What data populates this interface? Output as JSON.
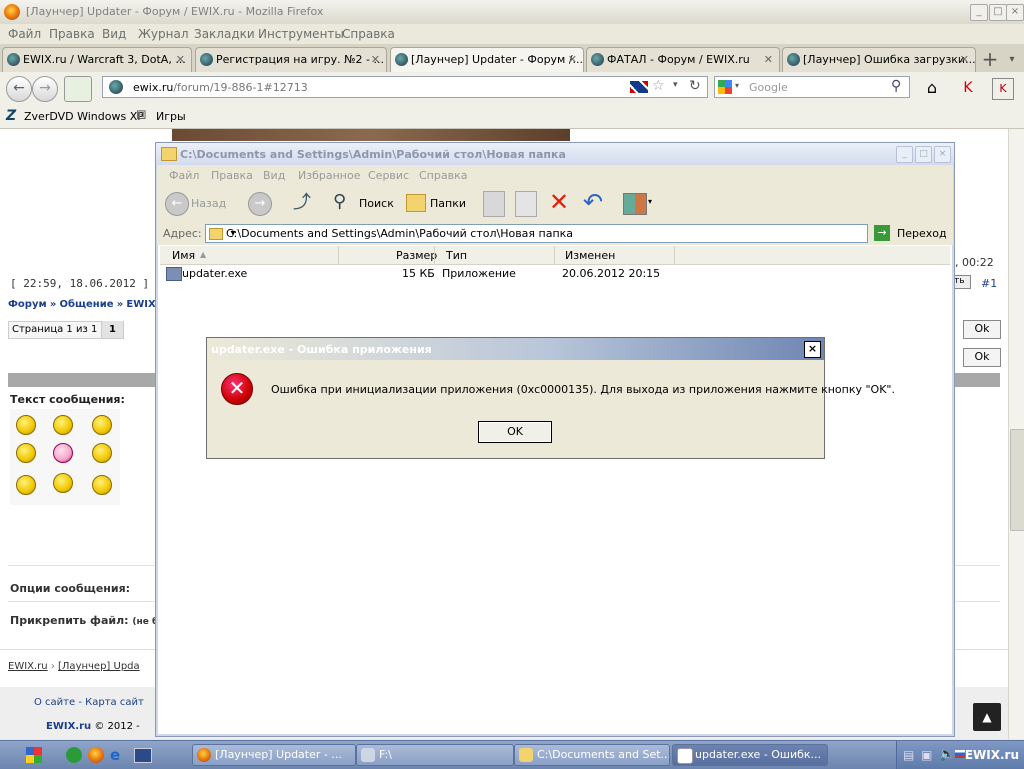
{
  "firefox": {
    "title": "[Лаунчер] Updater - Форум / EWIX.ru - Mozilla Firefox",
    "menu": [
      "Файл",
      "Правка",
      "Вид",
      "Журнал",
      "Закладки",
      "Инструменты",
      "Справка"
    ],
    "tabs": [
      {
        "label": "EWIX.ru / Warcraft 3, DotA, ..."
      },
      {
        "label": "Регистрация на игру. №2 - ..."
      },
      {
        "label": "[Лаунчер] Updater - Форум /..."
      },
      {
        "label": "ФАТАЛ - Форум / EWIX.ru"
      },
      {
        "label": "[Лаунчер] Ошибка загрузки..."
      }
    ],
    "url_host": "ewix.ru",
    "url_path": "/forum/19-886-1#12713",
    "search_placeholder": "Google",
    "bookmarks": [
      "ZverDVD Windows XP",
      "Игры"
    ]
  },
  "page": {
    "timestamp": "[ 22:59, 18.06.2012 ]",
    "timestamp_right": ", 00:22",
    "post_number": "#1",
    "breadcrumb_forum": "Форум",
    "breadcrumb_general": "Общение",
    "breadcrumb_ewix": "EWIX.",
    "pager_text": "Страница 1 из 1",
    "pager_current": "1",
    "ok_label": "Ok",
    "message_label": "Текст сообщения:",
    "options_label": "Опции сообщения:",
    "attach_label": "Прикрепить файл:",
    "attach_note": "(не б",
    "footer_crumb_site": "EWIX.ru",
    "footer_crumb_topic": "[Лаунчер] Upda",
    "footer_links": "О сайте - Карта сайт",
    "footer_copy_brand": "EWIX.ru",
    "footer_copy": " © 2012 -",
    "page_button_ok_partial": "ть"
  },
  "explorer": {
    "title": "C:\\Documents and Settings\\Admin\\Рабочий стол\\Новая папка",
    "menu": [
      "Файл",
      "Правка",
      "Вид",
      "Избранное",
      "Сервис",
      "Справка"
    ],
    "back_label": "Назад",
    "search_label": "Поиск",
    "folders_label": "Папки",
    "address_label": "Адрес:",
    "address_value": "C:\\Documents and Settings\\Admin\\Рабочий стол\\Новая папка",
    "go_label": "Переход",
    "columns": [
      "Имя",
      "Размер",
      "Тип",
      "Изменен"
    ],
    "files": [
      {
        "name": "updater.exe",
        "size": "15 КБ",
        "type": "Приложение",
        "modified": "20.06.2012 20:15"
      }
    ]
  },
  "dialog": {
    "title": "updater.exe - Ошибка приложения",
    "message": "Ошибка при инициализации приложения (0xc0000135). Для выхода из приложения нажмите кнопку \"OK\".",
    "ok": "OK",
    "close": "×"
  },
  "taskbar": {
    "tasks": [
      {
        "label": "[Лаунчер] Updater - ..."
      },
      {
        "label": "F:\\"
      },
      {
        "label": "C:\\Documents and Set..."
      },
      {
        "label": "updater.exe - Ошибк..."
      }
    ],
    "watermark": "EWIX.ru"
  }
}
